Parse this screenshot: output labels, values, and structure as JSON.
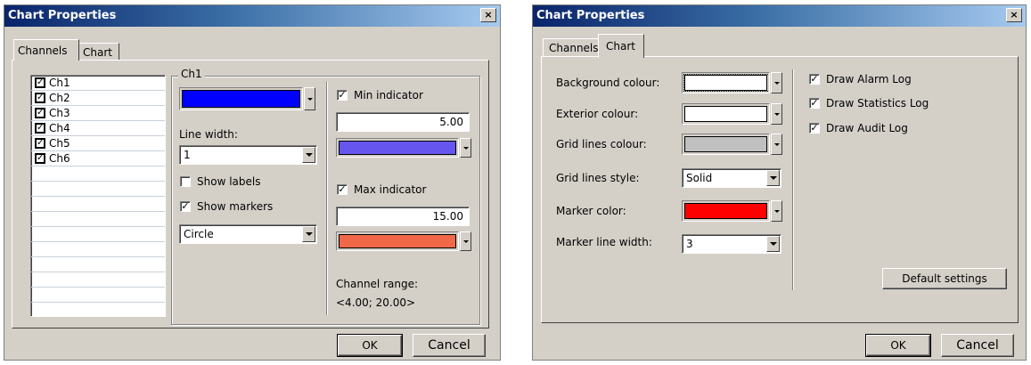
{
  "left_dialog": {
    "title": "Chart Properties",
    "close_glyph": "×",
    "tabs": [
      "Channels",
      "Chart"
    ],
    "active_tab": "Channels",
    "channels": [
      {
        "label": "Ch1",
        "checked": true
      },
      {
        "label": "Ch2",
        "checked": true
      },
      {
        "label": "Ch3",
        "checked": true
      },
      {
        "label": "Ch4",
        "checked": true
      },
      {
        "label": "Ch5",
        "checked": true
      },
      {
        "label": "Ch6",
        "checked": true
      }
    ],
    "group_label": "Ch1",
    "channel_color": "#0000ff",
    "line_width_label": "Line width:",
    "line_width_value": "1",
    "show_labels": {
      "label": "Show labels",
      "checked": false
    },
    "show_markers": {
      "label": "Show markers",
      "checked": true
    },
    "marker_shape": "Circle",
    "min_indicator": {
      "label": "Min indicator",
      "checked": true,
      "value": "5.00",
      "color": "#6655ee"
    },
    "max_indicator": {
      "label": "Max indicator",
      "checked": true,
      "value": "15.00",
      "color": "#f06848"
    },
    "channel_range_label": "Channel range:",
    "channel_range_value": "<4.00; 20.00>",
    "ok_label": "OK",
    "cancel_label": "Cancel"
  },
  "right_dialog": {
    "title": "Chart Properties",
    "close_glyph": "×",
    "tabs": [
      "Channels",
      "Chart"
    ],
    "active_tab": "Chart",
    "background_colour_label": "Background colour:",
    "background_colour": "#ffffff",
    "exterior_colour_label": "Exterior colour:",
    "exterior_colour": "#ffffff",
    "grid_lines_colour_label": "Grid lines colour:",
    "grid_lines_colour": "#c0c0c0",
    "grid_lines_style_label": "Grid lines style:",
    "grid_lines_style_value": "Solid",
    "marker_color_label": "Marker color:",
    "marker_color": "#ff0000",
    "marker_line_width_label": "Marker line width:",
    "marker_line_width_value": "3",
    "draw_alarm_log": {
      "label": "Draw Alarm Log",
      "checked": true
    },
    "draw_statistics_log": {
      "label": "Draw Statistics Log",
      "checked": true
    },
    "draw_audit_log": {
      "label": "Draw Audit Log",
      "checked": true
    },
    "default_settings_label": "Default settings",
    "ok_label": "OK",
    "cancel_label": "Cancel"
  },
  "check_glyph": "✓"
}
